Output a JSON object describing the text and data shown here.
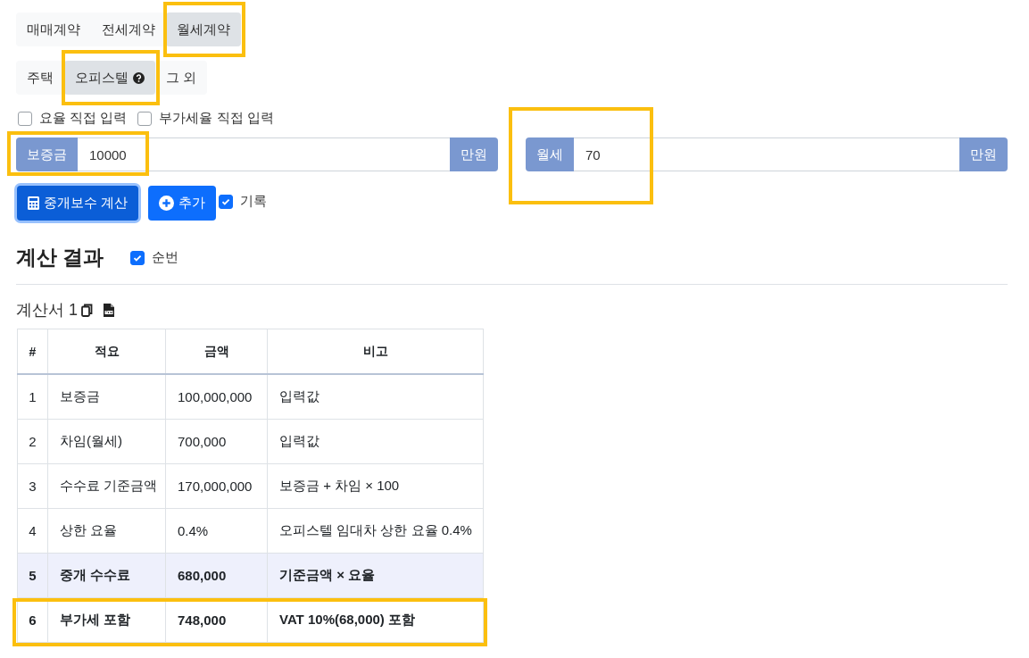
{
  "contract_tabs": [
    {
      "label": "매매계약",
      "selected": false,
      "highlighted": false
    },
    {
      "label": "전세계약",
      "selected": false,
      "highlighted": false
    },
    {
      "label": "월세계약",
      "selected": true,
      "highlighted": true
    }
  ],
  "property_tabs": [
    {
      "label": "주택",
      "selected": false,
      "help_icon": false,
      "highlighted": false
    },
    {
      "label": "오피스텔",
      "selected": true,
      "help_icon": true,
      "highlighted": true
    },
    {
      "label": "그 외",
      "selected": false,
      "help_icon": false,
      "highlighted": false
    }
  ],
  "options": [
    {
      "label": "요율 직접 입력",
      "checked": false
    },
    {
      "label": "부가세율 직접 입력",
      "checked": false
    }
  ],
  "inputs": [
    {
      "label": "보증금",
      "value": "10000",
      "unit": "만원",
      "highlighted": true
    },
    {
      "label": "월세",
      "value": "70",
      "unit": "만원",
      "highlighted": true
    }
  ],
  "actions": {
    "calculate": "중개보수 계산",
    "add": "추가",
    "record": {
      "label": "기록",
      "checked": true
    }
  },
  "result": {
    "title": "계산 결과",
    "numbering": {
      "label": "순번",
      "checked": true
    },
    "sheet_title": "계산서 1",
    "columns": [
      "#",
      "적요",
      "금액",
      "비고"
    ],
    "rows": [
      {
        "cells": [
          "1",
          "보증금",
          "100,000,000",
          "입력값"
        ],
        "kind": "normal",
        "highlighted": false
      },
      {
        "cells": [
          "2",
          "차임(월세)",
          "700,000",
          "입력값"
        ],
        "kind": "normal",
        "highlighted": false
      },
      {
        "cells": [
          "3",
          "수수료 기준금액",
          "170,000,000",
          "보증금 + 차임 × 100"
        ],
        "kind": "normal",
        "highlighted": false
      },
      {
        "cells": [
          "4",
          "상한 요율",
          "0.4%",
          "오피스텔 임대차 상한 요율 0.4%"
        ],
        "kind": "normal",
        "highlighted": false
      },
      {
        "cells": [
          "5",
          "중개 수수료",
          "680,000",
          "기준금액 × 요율"
        ],
        "kind": "subtotal",
        "highlighted": false
      },
      {
        "cells": [
          "6",
          "부가세 포함",
          "748,000",
          "VAT 10%(68,000) 포함"
        ],
        "kind": "total",
        "highlighted": true
      }
    ]
  }
}
